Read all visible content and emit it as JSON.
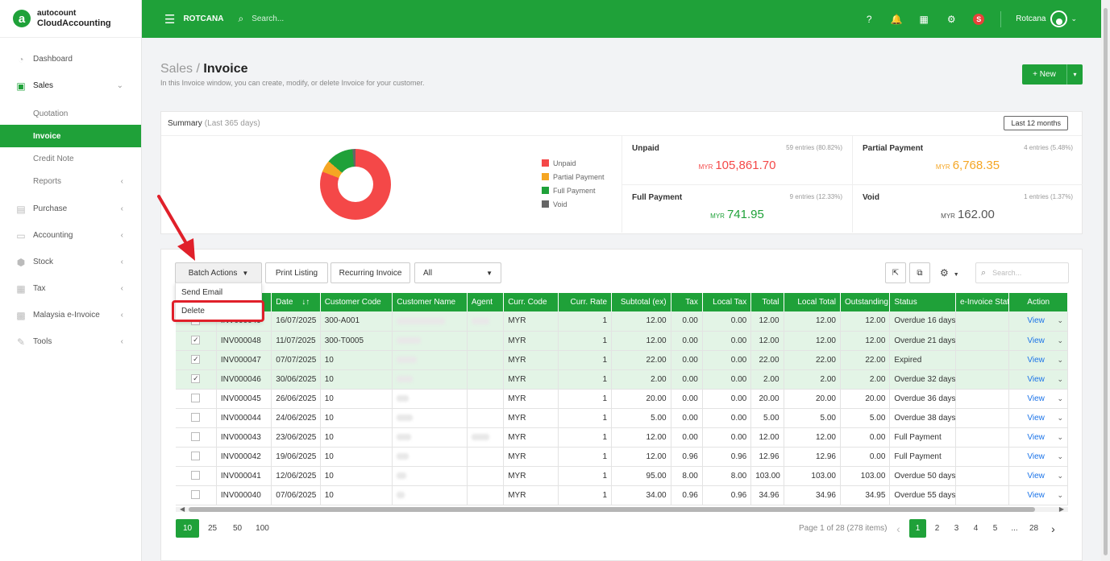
{
  "brand": {
    "line1": "autocount",
    "line2": "CloudAccounting",
    "logo_letter": "a"
  },
  "sidebar": {
    "items": [
      {
        "label": "Dashboard",
        "icon": "dashboard-icon"
      },
      {
        "label": "Sales",
        "icon": "sales-icon",
        "open": true
      },
      {
        "label": "Purchase",
        "icon": "purchase-icon"
      },
      {
        "label": "Accounting",
        "icon": "accounting-icon"
      },
      {
        "label": "Stock",
        "icon": "stock-icon"
      },
      {
        "label": "Tax",
        "icon": "tax-icon"
      },
      {
        "label": "Malaysia e-Invoice",
        "icon": "einvoice-icon"
      },
      {
        "label": "Tools",
        "icon": "tools-icon"
      }
    ],
    "sales_sub": [
      {
        "label": "Quotation"
      },
      {
        "label": "Invoice",
        "active": true
      },
      {
        "label": "Credit Note"
      },
      {
        "label": "Reports"
      }
    ]
  },
  "topbar": {
    "company": "ROTCANA",
    "search_placeholder": "Search...",
    "user": "Rotcana",
    "badge": "S",
    "accent": "#1fa139"
  },
  "page": {
    "breadcrumb": "Sales",
    "separator": "/",
    "title": "Invoice",
    "description": "In this Invoice window, you can create, modify, or delete Invoice for your customer.",
    "new_button": "New"
  },
  "summary": {
    "heading": "Summary",
    "period": "(Last 365 days)",
    "range_button": "Last 12 months",
    "legend": [
      {
        "label": "Unpaid",
        "color": "#f44848"
      },
      {
        "label": "Partial Payment",
        "color": "#f5a623"
      },
      {
        "label": "Full Payment",
        "color": "#1fa139"
      },
      {
        "label": "Void",
        "color": "#666666"
      }
    ],
    "stats": [
      {
        "label": "Unpaid",
        "count": "59 entries (80.82%)",
        "currency": "MYR",
        "amount": "105,861.70",
        "color": "#f44848"
      },
      {
        "label": "Partial Payment",
        "count": "4 entries (5.48%)",
        "currency": "MYR",
        "amount": "6,768.35",
        "color": "#f5a623"
      },
      {
        "label": "Full Payment",
        "count": "9 entries (12.33%)",
        "currency": "MYR",
        "amount": "741.95",
        "color": "#1fa139"
      },
      {
        "label": "Void",
        "count": "1 entries (1.37%)",
        "currency": "MYR",
        "amount": "162.00",
        "color": "#555555"
      }
    ]
  },
  "toolbar": {
    "batch_actions": "Batch Actions",
    "print_listing": "Print Listing",
    "recurring_invoice": "Recurring Invoice",
    "filter_value": "All",
    "search_placeholder": "Search..."
  },
  "batch_menu": {
    "items": [
      "Send Email",
      "Delete"
    ],
    "highlighted": "Delete"
  },
  "table": {
    "columns": [
      "",
      "Doc No.",
      "Date",
      "Customer Code",
      "Customer Name",
      "Agent",
      "Curr. Code",
      "Curr. Rate",
      "Subtotal (ex)",
      "Tax",
      "Local Tax",
      "Total",
      "Local Total",
      "Outstanding",
      "Status",
      "e-Invoice Status",
      "Action"
    ],
    "rows": [
      {
        "checked": false,
        "doc": "INV000049",
        "date": "16/07/2025",
        "code": "300-A001",
        "curr": "MYR",
        "rate": "1",
        "subtotal": "12.00",
        "tax": "0.00",
        "local_tax": "0.00",
        "total": "12.00",
        "local_total": "12.00",
        "outstanding": "12.00",
        "status": "Overdue 16 days",
        "action": "View",
        "selected": true
      },
      {
        "checked": true,
        "doc": "INV000048",
        "date": "11/07/2025",
        "code": "300-T0005",
        "curr": "MYR",
        "rate": "1",
        "subtotal": "12.00",
        "tax": "0.00",
        "local_tax": "0.00",
        "total": "12.00",
        "local_total": "12.00",
        "outstanding": "12.00",
        "status": "Overdue 21 days",
        "action": "View",
        "selected": true
      },
      {
        "checked": true,
        "doc": "INV000047",
        "date": "07/07/2025",
        "code": "10",
        "curr": "MYR",
        "rate": "1",
        "subtotal": "22.00",
        "tax": "0.00",
        "local_tax": "0.00",
        "total": "22.00",
        "local_total": "22.00",
        "outstanding": "22.00",
        "status": "Expired",
        "action": "View",
        "selected": true
      },
      {
        "checked": true,
        "doc": "INV000046",
        "date": "30/06/2025",
        "code": "10",
        "curr": "MYR",
        "rate": "1",
        "subtotal": "2.00",
        "tax": "0.00",
        "local_tax": "0.00",
        "total": "2.00",
        "local_total": "2.00",
        "outstanding": "2.00",
        "status": "Overdue 32 days",
        "action": "View",
        "selected": true
      },
      {
        "checked": false,
        "doc": "INV000045",
        "date": "26/06/2025",
        "code": "10",
        "curr": "MYR",
        "rate": "1",
        "subtotal": "20.00",
        "tax": "0.00",
        "local_tax": "0.00",
        "total": "20.00",
        "local_total": "20.00",
        "outstanding": "20.00",
        "status": "Overdue 36 days",
        "action": "View",
        "selected": false
      },
      {
        "checked": false,
        "doc": "INV000044",
        "date": "24/06/2025",
        "code": "10",
        "curr": "MYR",
        "rate": "1",
        "subtotal": "5.00",
        "tax": "0.00",
        "local_tax": "0.00",
        "total": "5.00",
        "local_total": "5.00",
        "outstanding": "5.00",
        "status": "Overdue 38 days",
        "action": "View",
        "selected": false
      },
      {
        "checked": false,
        "doc": "INV000043",
        "date": "23/06/2025",
        "code": "10",
        "curr": "MYR",
        "rate": "1",
        "subtotal": "12.00",
        "tax": "0.00",
        "local_tax": "0.00",
        "total": "12.00",
        "local_total": "12.00",
        "outstanding": "0.00",
        "status": "Full Payment",
        "action": "View",
        "selected": false
      },
      {
        "checked": false,
        "doc": "INV000042",
        "date": "19/06/2025",
        "code": "10",
        "curr": "MYR",
        "rate": "1",
        "subtotal": "12.00",
        "tax": "0.96",
        "local_tax": "0.96",
        "total": "12.96",
        "local_total": "12.96",
        "outstanding": "0.00",
        "status": "Full Payment",
        "action": "View",
        "selected": false
      },
      {
        "checked": false,
        "doc": "INV000041",
        "date": "12/06/2025",
        "code": "10",
        "curr": "MYR",
        "rate": "1",
        "subtotal": "95.00",
        "tax": "8.00",
        "local_tax": "8.00",
        "total": "103.00",
        "local_total": "103.00",
        "outstanding": "103.00",
        "status": "Overdue 50 days",
        "action": "View",
        "selected": false
      },
      {
        "checked": false,
        "doc": "INV000040",
        "date": "07/06/2025",
        "code": "10",
        "curr": "MYR",
        "rate": "1",
        "subtotal": "34.00",
        "tax": "0.96",
        "local_tax": "0.96",
        "total": "34.96",
        "local_total": "34.96",
        "outstanding": "34.95",
        "status": "Overdue 55 days",
        "action": "View",
        "selected": false
      }
    ]
  },
  "pagination": {
    "page_sizes": [
      "10",
      "25",
      "50",
      "100"
    ],
    "active_size": "10",
    "info": "Page 1 of 28 (278 items)",
    "pages": [
      "1",
      "2",
      "3",
      "4",
      "5"
    ],
    "ellipsis": "...",
    "last_page": "28",
    "current": "1"
  }
}
